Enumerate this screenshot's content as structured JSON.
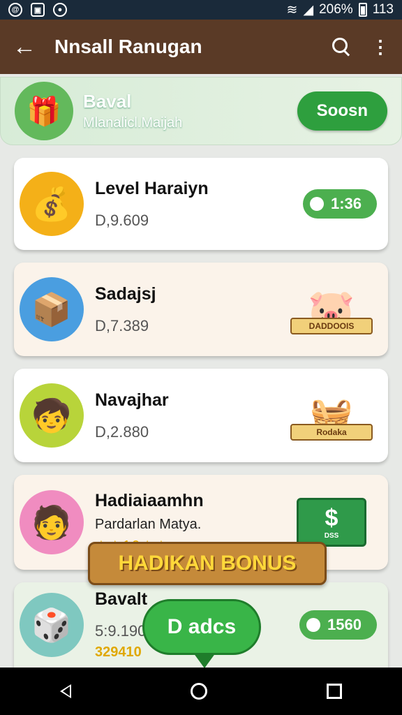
{
  "status": {
    "right_text": "206%",
    "time": "113"
  },
  "appbar": {
    "title": "Nnsall Ranugan",
    "back_label": "←"
  },
  "banner": {
    "title": "Baval",
    "subtitle": "Mlanalicl.Maijah",
    "button": "Soosn"
  },
  "cards": [
    {
      "name": "Level Haraiyn",
      "amount": "D,9.609",
      "pill": "1:36"
    },
    {
      "name": "Sadajsj",
      "amount": "D,7.389",
      "badge": "DADDOOIS"
    },
    {
      "name": "Navajhar",
      "amount": "D,2.880",
      "badge": "Rodaka"
    },
    {
      "name": "Hadiaiaamhn",
      "subtitle": "Pardarlan Matya.",
      "rating_text": "★★10★★",
      "box_text": "DSS"
    },
    {
      "name": "Bavalt",
      "amount": "5:9.190",
      "coins": "329410",
      "pill": "1560"
    }
  ],
  "overlay": {
    "bonus": "HADIKAN BONUS",
    "bubble": "D adcs"
  },
  "colors": {
    "appbar": "#5a3a26",
    "accent": "#2e9f3e",
    "statusbar": "#1a2a3a"
  }
}
